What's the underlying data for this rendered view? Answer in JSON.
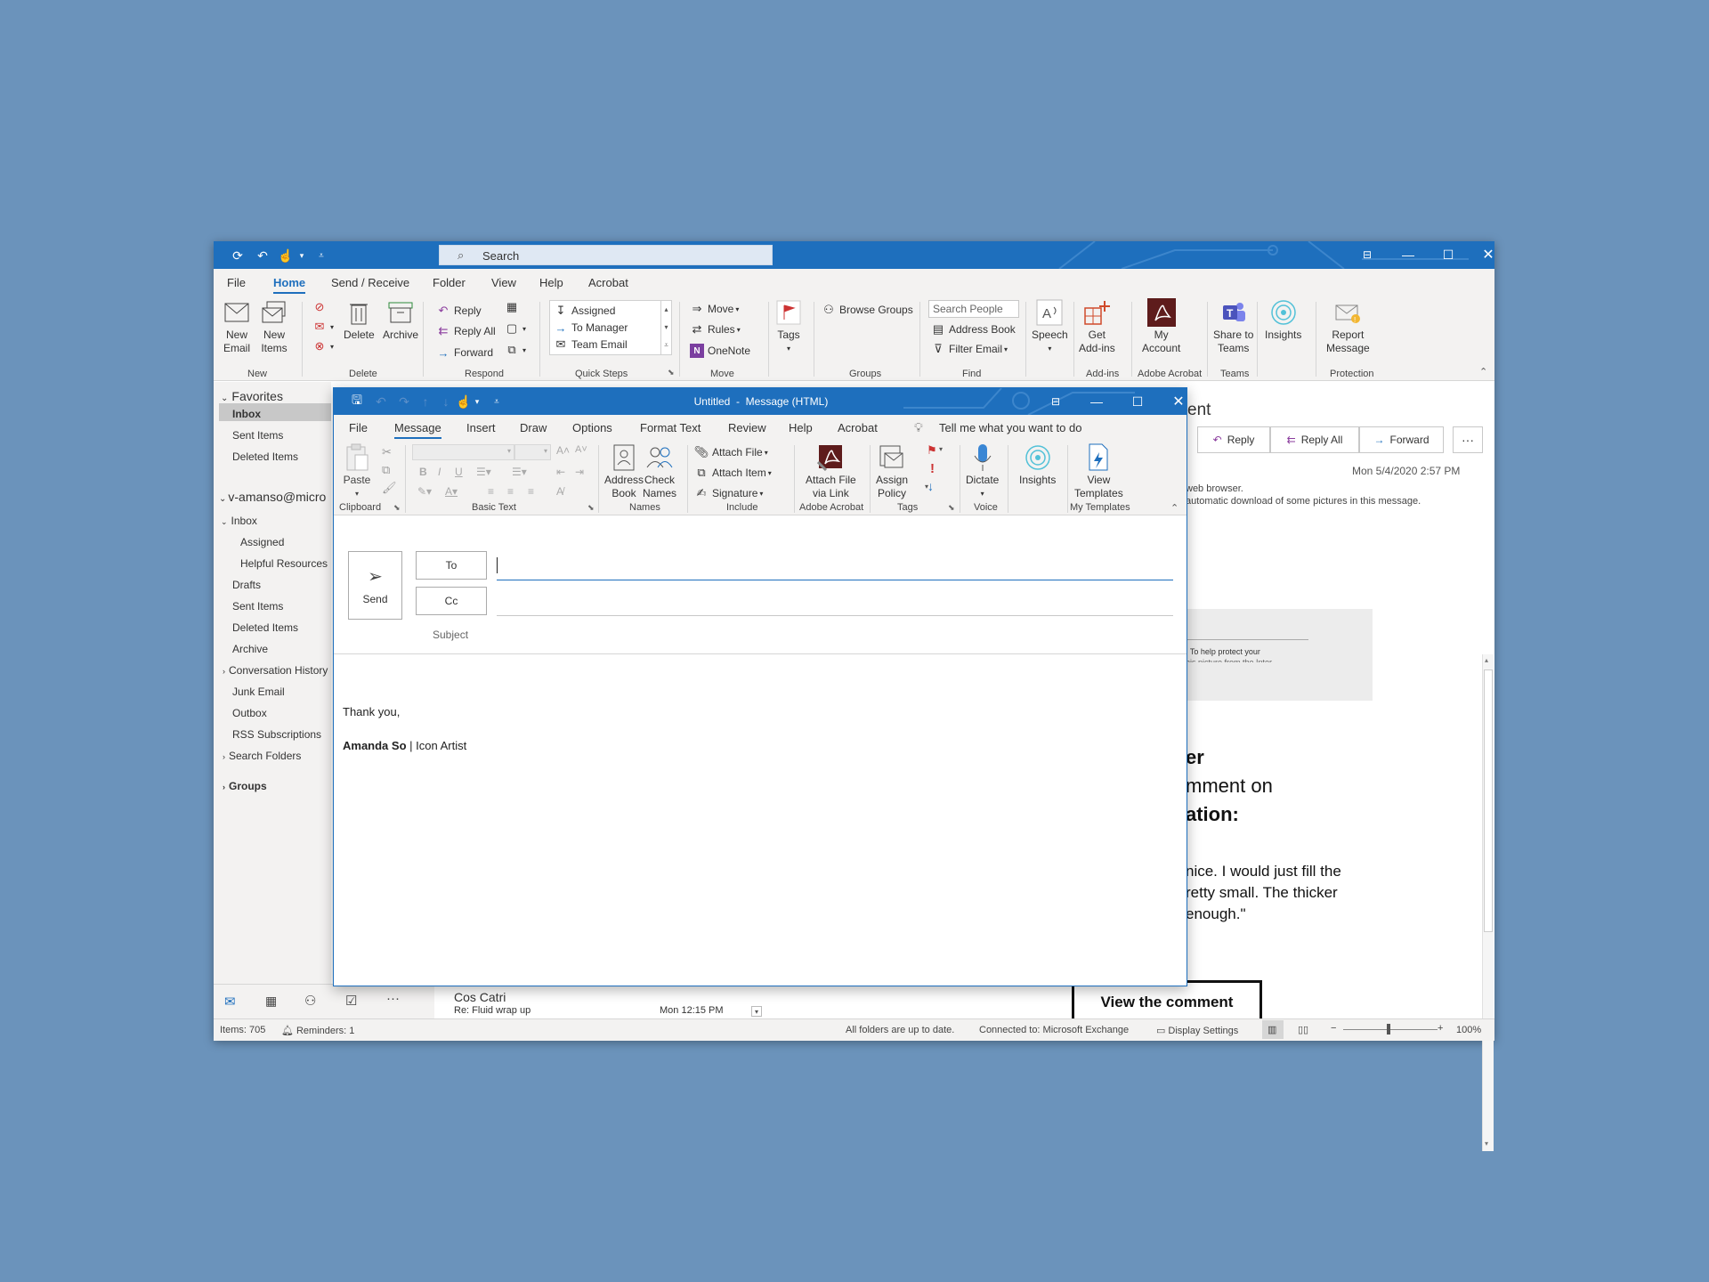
{
  "main": {
    "search_placeholder": "Search",
    "menu_tabs": [
      "File",
      "Home",
      "Send / Receive",
      "Folder",
      "View",
      "Help",
      "Acrobat"
    ],
    "ribbon": {
      "new_email": "New\nEmail",
      "new_items": "New\nItems",
      "new_group": "New",
      "delete": "Delete",
      "archive": "Archive",
      "delete_group": "Delete",
      "reply": "Reply",
      "reply_all": "Reply All",
      "forward": "Forward",
      "respond_group": "Respond",
      "qs_assigned": "Assigned",
      "qs_to_manager": "To Manager",
      "qs_team_email": "Team Email",
      "quick_steps_group": "Quick Steps",
      "move": "Move",
      "rules": "Rules",
      "onenote": "OneNote",
      "move_group": "Move",
      "tags": "Tags",
      "browse_groups": "Browse Groups",
      "groups_group": "Groups",
      "search_people": "Search People",
      "address_book": "Address Book",
      "filter_email": "Filter Email",
      "find_group": "Find",
      "speech": "Speech",
      "get_addins": "Get\nAdd-ins",
      "addins_group": "Add-ins",
      "my_account": "My\nAccount",
      "acrobat_group": "Adobe Acrobat",
      "share_teams": "Share to\nTeams",
      "teams_group": "Teams",
      "insights": "Insights",
      "report_message": "Report\nMessage",
      "protection_group": "Protection"
    },
    "nav": {
      "favorites": "Favorites",
      "fav_inbox": "Inbox",
      "fav_sent": "Sent Items",
      "fav_deleted": "Deleted Items",
      "account": "v-amanso@micro",
      "inbox": "Inbox",
      "assigned": "Assigned",
      "helpful": "Helpful Resources",
      "drafts": "Drafts",
      "sent": "Sent Items",
      "deleted": "Deleted Items",
      "archive": "Archive",
      "conv_history": "Conversation History",
      "junk": "Junk Email",
      "outbox": "Outbox",
      "rss": "RSS Subscriptions",
      "search_folders": "Search Folders",
      "groups": "Groups"
    },
    "message_list_item": {
      "sender": "Cos Catri",
      "subject": "Re: Fluid wrap up",
      "time": "Mon 12:15 PM"
    },
    "reading": {
      "title_fragment": "ent",
      "reply": "Reply",
      "reply_all": "Reply All",
      "forward": "Forward",
      "date": "Mon 5/4/2020 2:57 PM",
      "info1": "web browser.",
      "info2": "automatic download of some pictures in this message.",
      "img_text1": ". To help protect your",
      "img_text2": "his picture from the Inter",
      "body_h1": "er",
      "body_h2": "mment on",
      "body_h3": "ation:",
      "body_p1": "nice. I would just fill the",
      "body_p2": "retty small. The thicker",
      "body_p3": "enough.\"",
      "view_comment": "View the comment"
    },
    "status": {
      "items": "Items: 705",
      "reminders": "Reminders: 1",
      "sync": "All folders are up to date.",
      "connected": "Connected to: Microsoft Exchange",
      "display": "Display Settings",
      "zoom": "100%"
    }
  },
  "compose": {
    "title": "Untitled  -  Message (HTML)",
    "menu_tabs": [
      "File",
      "Message",
      "Insert",
      "Draw",
      "Options",
      "Format Text",
      "Review",
      "Help",
      "Acrobat"
    ],
    "tell_me": "Tell me what you want to do",
    "ribbon": {
      "paste": "Paste",
      "clipboard": "Clipboard",
      "basic_text": "Basic Text",
      "address_book": "Address\nBook",
      "check_names": "Check\nNames",
      "names": "Names",
      "attach_file": "Attach File",
      "attach_item": "Attach Item",
      "signature": "Signature",
      "include": "Include",
      "attach_link": "Attach File\nvia Link",
      "adobe_acrobat": "Adobe Acrobat",
      "assign_policy": "Assign\nPolicy",
      "tags": "Tags",
      "dictate": "Dictate",
      "voice": "Voice",
      "insights": "Insights",
      "view_templates": "View\nTemplates",
      "my_templates": "My Templates"
    },
    "send": "Send",
    "to": "To",
    "cc": "Cc",
    "subject": "Subject",
    "body_line1": "Thank you,",
    "sig_name": "Amanda So",
    "sig_sep": " | ",
    "sig_title": "Icon Artist"
  },
  "colors": {
    "accent": "#1e6fbd",
    "background": "#6b93bb",
    "ribbon": "#f3f2f1"
  }
}
